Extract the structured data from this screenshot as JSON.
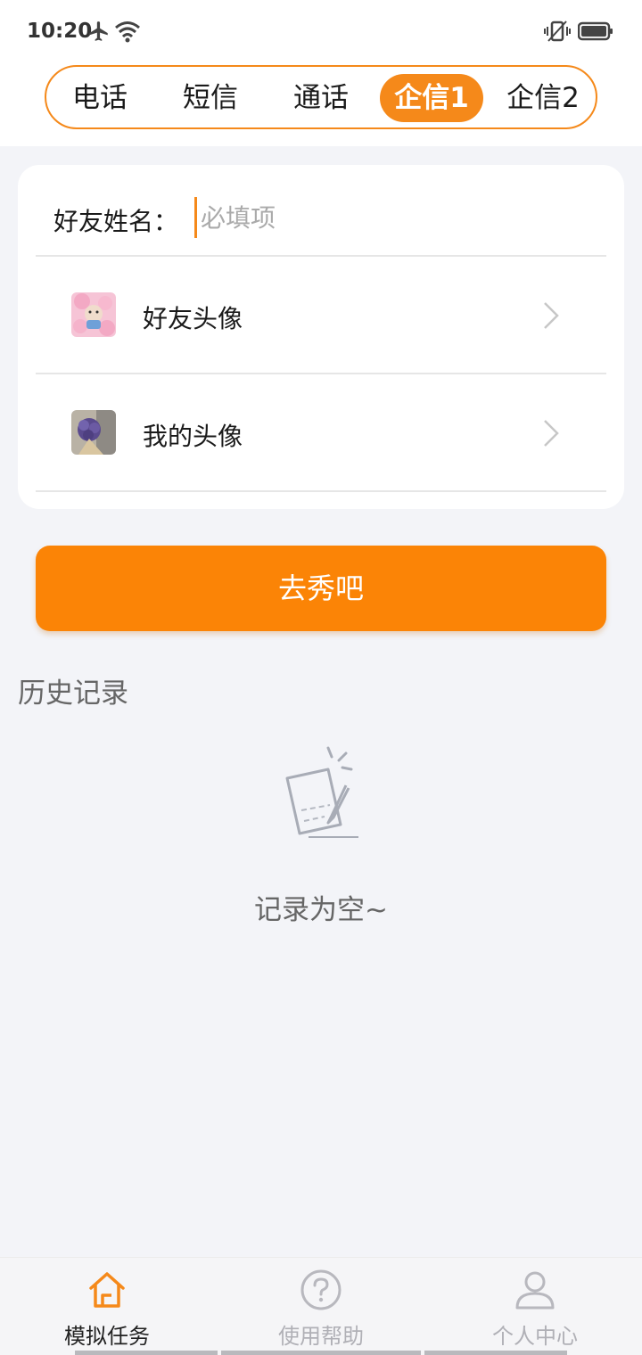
{
  "status_bar": {
    "time": "10:20"
  },
  "tabs": [
    {
      "label": "电话",
      "active": false
    },
    {
      "label": "短信",
      "active": false
    },
    {
      "label": "通话",
      "active": false
    },
    {
      "label": "企信1",
      "active": true
    },
    {
      "label": "企信2",
      "active": false
    }
  ],
  "form": {
    "name_label": "好友姓名：",
    "name_placeholder": "必填项",
    "name_value": "",
    "friend_avatar_label": "好友头像",
    "my_avatar_label": "我的头像"
  },
  "action": {
    "go_label": "去秀吧"
  },
  "history": {
    "title": "历史记录",
    "empty_text": "记录为空~"
  },
  "tabbar": {
    "items": [
      {
        "label": "模拟任务",
        "icon": "home-icon",
        "active": true
      },
      {
        "label": "使用帮助",
        "icon": "help-icon",
        "active": false
      },
      {
        "label": "个人中心",
        "icon": "person-icon",
        "active": false
      }
    ]
  },
  "colors": {
    "accent": "#f5891a",
    "button": "#fb8406",
    "background": "#f3f4f8",
    "tab_active": "#f5891a",
    "tab_inactive": "#b8b8be"
  }
}
